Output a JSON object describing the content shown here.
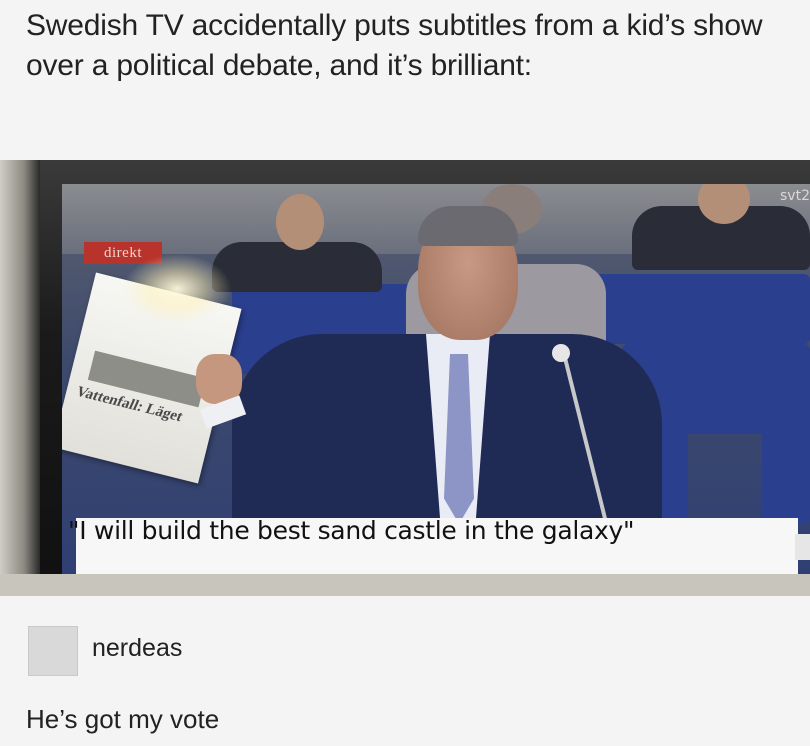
{
  "post": {
    "title": "Swedish TV accidentally puts subtitles from a kid’s show over a political debate, and it’s brilliant:"
  },
  "photo": {
    "live_badge": "direkt",
    "channel_logo": "svt2",
    "newspaper_headline": "Vattenfall: Läget",
    "subtitle": "\"I will build the best sand castle in the galaxy\""
  },
  "comment": {
    "username": "nerdeas",
    "text": "He’s got my vote"
  }
}
